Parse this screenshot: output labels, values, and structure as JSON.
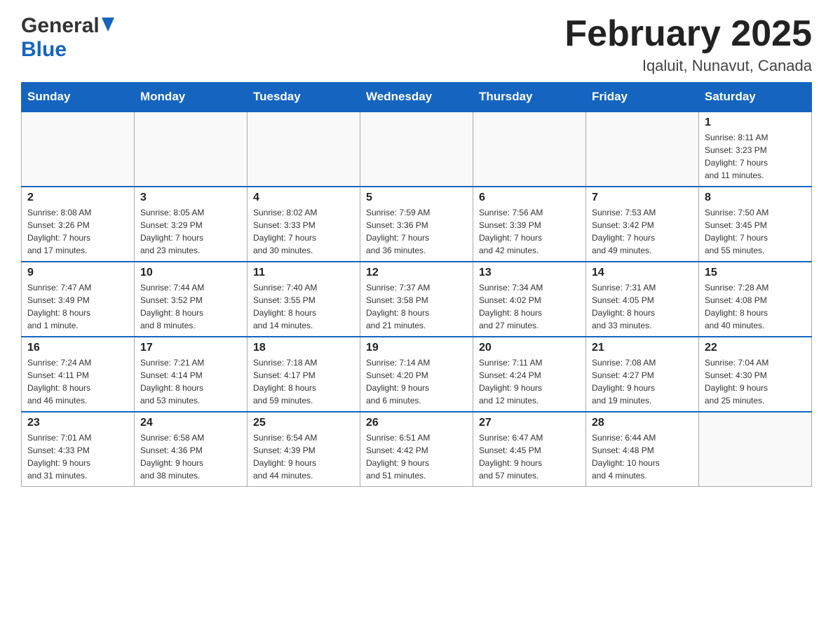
{
  "header": {
    "logo_general": "General",
    "logo_blue": "Blue",
    "title": "February 2025",
    "location": "Iqaluit, Nunavut, Canada"
  },
  "days_of_week": [
    "Sunday",
    "Monday",
    "Tuesday",
    "Wednesday",
    "Thursday",
    "Friday",
    "Saturday"
  ],
  "weeks": [
    [
      {
        "day": "",
        "info": ""
      },
      {
        "day": "",
        "info": ""
      },
      {
        "day": "",
        "info": ""
      },
      {
        "day": "",
        "info": ""
      },
      {
        "day": "",
        "info": ""
      },
      {
        "day": "",
        "info": ""
      },
      {
        "day": "1",
        "info": "Sunrise: 8:11 AM\nSunset: 3:23 PM\nDaylight: 7 hours\nand 11 minutes."
      }
    ],
    [
      {
        "day": "2",
        "info": "Sunrise: 8:08 AM\nSunset: 3:26 PM\nDaylight: 7 hours\nand 17 minutes."
      },
      {
        "day": "3",
        "info": "Sunrise: 8:05 AM\nSunset: 3:29 PM\nDaylight: 7 hours\nand 23 minutes."
      },
      {
        "day": "4",
        "info": "Sunrise: 8:02 AM\nSunset: 3:33 PM\nDaylight: 7 hours\nand 30 minutes."
      },
      {
        "day": "5",
        "info": "Sunrise: 7:59 AM\nSunset: 3:36 PM\nDaylight: 7 hours\nand 36 minutes."
      },
      {
        "day": "6",
        "info": "Sunrise: 7:56 AM\nSunset: 3:39 PM\nDaylight: 7 hours\nand 42 minutes."
      },
      {
        "day": "7",
        "info": "Sunrise: 7:53 AM\nSunset: 3:42 PM\nDaylight: 7 hours\nand 49 minutes."
      },
      {
        "day": "8",
        "info": "Sunrise: 7:50 AM\nSunset: 3:45 PM\nDaylight: 7 hours\nand 55 minutes."
      }
    ],
    [
      {
        "day": "9",
        "info": "Sunrise: 7:47 AM\nSunset: 3:49 PM\nDaylight: 8 hours\nand 1 minute."
      },
      {
        "day": "10",
        "info": "Sunrise: 7:44 AM\nSunset: 3:52 PM\nDaylight: 8 hours\nand 8 minutes."
      },
      {
        "day": "11",
        "info": "Sunrise: 7:40 AM\nSunset: 3:55 PM\nDaylight: 8 hours\nand 14 minutes."
      },
      {
        "day": "12",
        "info": "Sunrise: 7:37 AM\nSunset: 3:58 PM\nDaylight: 8 hours\nand 21 minutes."
      },
      {
        "day": "13",
        "info": "Sunrise: 7:34 AM\nSunset: 4:02 PM\nDaylight: 8 hours\nand 27 minutes."
      },
      {
        "day": "14",
        "info": "Sunrise: 7:31 AM\nSunset: 4:05 PM\nDaylight: 8 hours\nand 33 minutes."
      },
      {
        "day": "15",
        "info": "Sunrise: 7:28 AM\nSunset: 4:08 PM\nDaylight: 8 hours\nand 40 minutes."
      }
    ],
    [
      {
        "day": "16",
        "info": "Sunrise: 7:24 AM\nSunset: 4:11 PM\nDaylight: 8 hours\nand 46 minutes."
      },
      {
        "day": "17",
        "info": "Sunrise: 7:21 AM\nSunset: 4:14 PM\nDaylight: 8 hours\nand 53 minutes."
      },
      {
        "day": "18",
        "info": "Sunrise: 7:18 AM\nSunset: 4:17 PM\nDaylight: 8 hours\nand 59 minutes."
      },
      {
        "day": "19",
        "info": "Sunrise: 7:14 AM\nSunset: 4:20 PM\nDaylight: 9 hours\nand 6 minutes."
      },
      {
        "day": "20",
        "info": "Sunrise: 7:11 AM\nSunset: 4:24 PM\nDaylight: 9 hours\nand 12 minutes."
      },
      {
        "day": "21",
        "info": "Sunrise: 7:08 AM\nSunset: 4:27 PM\nDaylight: 9 hours\nand 19 minutes."
      },
      {
        "day": "22",
        "info": "Sunrise: 7:04 AM\nSunset: 4:30 PM\nDaylight: 9 hours\nand 25 minutes."
      }
    ],
    [
      {
        "day": "23",
        "info": "Sunrise: 7:01 AM\nSunset: 4:33 PM\nDaylight: 9 hours\nand 31 minutes."
      },
      {
        "day": "24",
        "info": "Sunrise: 6:58 AM\nSunset: 4:36 PM\nDaylight: 9 hours\nand 38 minutes."
      },
      {
        "day": "25",
        "info": "Sunrise: 6:54 AM\nSunset: 4:39 PM\nDaylight: 9 hours\nand 44 minutes."
      },
      {
        "day": "26",
        "info": "Sunrise: 6:51 AM\nSunset: 4:42 PM\nDaylight: 9 hours\nand 51 minutes."
      },
      {
        "day": "27",
        "info": "Sunrise: 6:47 AM\nSunset: 4:45 PM\nDaylight: 9 hours\nand 57 minutes."
      },
      {
        "day": "28",
        "info": "Sunrise: 6:44 AM\nSunset: 4:48 PM\nDaylight: 10 hours\nand 4 minutes."
      },
      {
        "day": "",
        "info": ""
      }
    ]
  ]
}
